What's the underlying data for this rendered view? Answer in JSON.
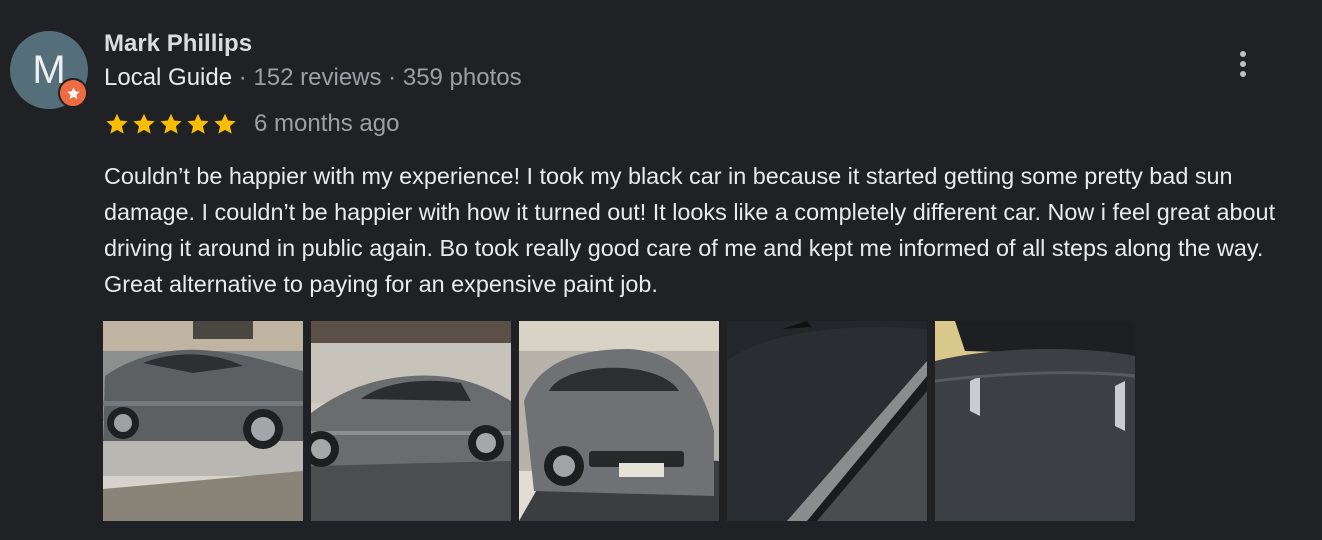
{
  "review": {
    "author": {
      "initial": "M",
      "name": "Mark Phillips",
      "level": "Local Guide",
      "reviews": "152 reviews",
      "photos": "359 photos",
      "separator": "·",
      "badge_icon": "star-badge-icon"
    },
    "rating": 5,
    "rating_max": 5,
    "date": "6 months ago",
    "text": "Couldn’t be happier with my experience! I took my black car in because it started getting some pretty bad sun damage. I couldn’t be happier with how it turned out! It looks like a completely different car. Now i feel great about driving it around in public again. Bo took really good care of me and kept me informed of all steps along the way. Great alternative to paying for an expensive paint job.",
    "photo_count": 5
  },
  "colors": {
    "background": "#202124",
    "star": "#fbbc04",
    "avatar": "#546e7a",
    "badge": "#ef6c42",
    "muted_text": "#9aa0a6"
  }
}
